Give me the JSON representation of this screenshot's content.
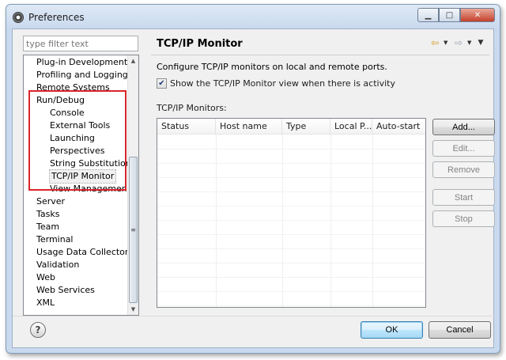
{
  "window": {
    "title": "Preferences"
  },
  "filter": {
    "placeholder": "type filter text"
  },
  "tree": {
    "items": [
      {
        "label": "Plug-in Development",
        "indent": 0
      },
      {
        "label": "Profiling and Logging",
        "indent": 0
      },
      {
        "label": "Remote Systems",
        "indent": 0
      },
      {
        "label": "Run/Debug",
        "indent": 0
      },
      {
        "label": "Console",
        "indent": 1
      },
      {
        "label": "External Tools",
        "indent": 1
      },
      {
        "label": "Launching",
        "indent": 1
      },
      {
        "label": "Perspectives",
        "indent": 1
      },
      {
        "label": "String Substitution",
        "indent": 1
      },
      {
        "label": "TCP/IP Monitor",
        "indent": 1,
        "selected": true
      },
      {
        "label": "View Management",
        "indent": 1
      },
      {
        "label": "Server",
        "indent": 0
      },
      {
        "label": "Tasks",
        "indent": 0
      },
      {
        "label": "Team",
        "indent": 0
      },
      {
        "label": "Terminal",
        "indent": 0
      },
      {
        "label": "Usage Data Collector",
        "indent": 0
      },
      {
        "label": "Validation",
        "indent": 0
      },
      {
        "label": "Web",
        "indent": 0
      },
      {
        "label": "Web Services",
        "indent": 0
      },
      {
        "label": "XML",
        "indent": 0
      }
    ]
  },
  "page": {
    "title": "TCP/IP Monitor",
    "description": "Configure TCP/IP monitors on local and remote ports.",
    "show_view_checkbox": {
      "label": "Show the TCP/IP Monitor view when there is activity",
      "checked": true
    },
    "monitors_label": "TCP/IP Monitors:",
    "columns": [
      "Status",
      "Host name",
      "Type",
      "Local P...",
      "Auto-start"
    ]
  },
  "buttons": {
    "add": "Add...",
    "edit": "Edit...",
    "remove": "Remove",
    "start": "Start",
    "stop": "Stop",
    "ok": "OK",
    "cancel": "Cancel",
    "help": "?"
  },
  "colors": {
    "highlight_box": "#d9252b",
    "back_arrow": "#d49a1a"
  }
}
